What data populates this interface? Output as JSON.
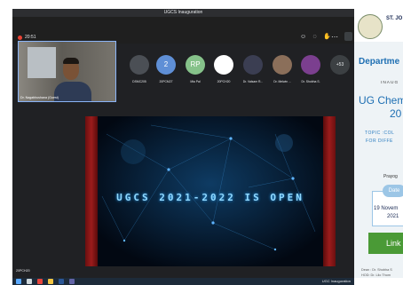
{
  "window": {
    "title": "UGCS Inauguration"
  },
  "meeting": {
    "timer": "20:51",
    "toolbar_icons": [
      "people-icon",
      "chat-icon",
      "reactions-icon",
      "more-icon"
    ]
  },
  "speaker": {
    "name": "Dr. Nagabhushana (Guest)"
  },
  "participants": [
    {
      "label": "DSMC205",
      "initials": "",
      "color": "#4b4f55"
    },
    {
      "label": "20PCM27",
      "initials": "2",
      "color": "#5f8fd6"
    },
    {
      "label": "Mia Pal",
      "initials": "RP",
      "color": "#86c28a"
    },
    {
      "label": "20PCH20",
      "initials": "",
      "color": "#ffffff"
    },
    {
      "label": "Dr. Valsam R...",
      "initials": "",
      "color": "#3b3e52"
    },
    {
      "label": "Dr. Melwin ...",
      "initials": "",
      "color": "#8b6f5a"
    },
    {
      "label": "Dr. Shobha S.",
      "initials": "",
      "color": "#7b3f8f"
    }
  ],
  "more_count": "+53",
  "stage": {
    "banner": "UGCS 2021-2022 IS OPEN"
  },
  "presenter_label": "20PCH20",
  "taskbar": {
    "tray": "UGC Inauguration"
  },
  "poster": {
    "college": "ST. JO",
    "department": "Departme",
    "inaugural": "INAUG",
    "title_line1": "UG Chem",
    "title_line2": "20",
    "topic_line1": "TOPIC :COL",
    "topic_line2": "FOR DIFFE",
    "prayog": "Prayog",
    "date_label": "Date",
    "date_line1": "19 Novem",
    "date_line2": "2021",
    "link_label": "Link",
    "convenor": "Dean : Dr. Shobha S",
    "hod": "HOD: Dr. Lilo Thom"
  }
}
